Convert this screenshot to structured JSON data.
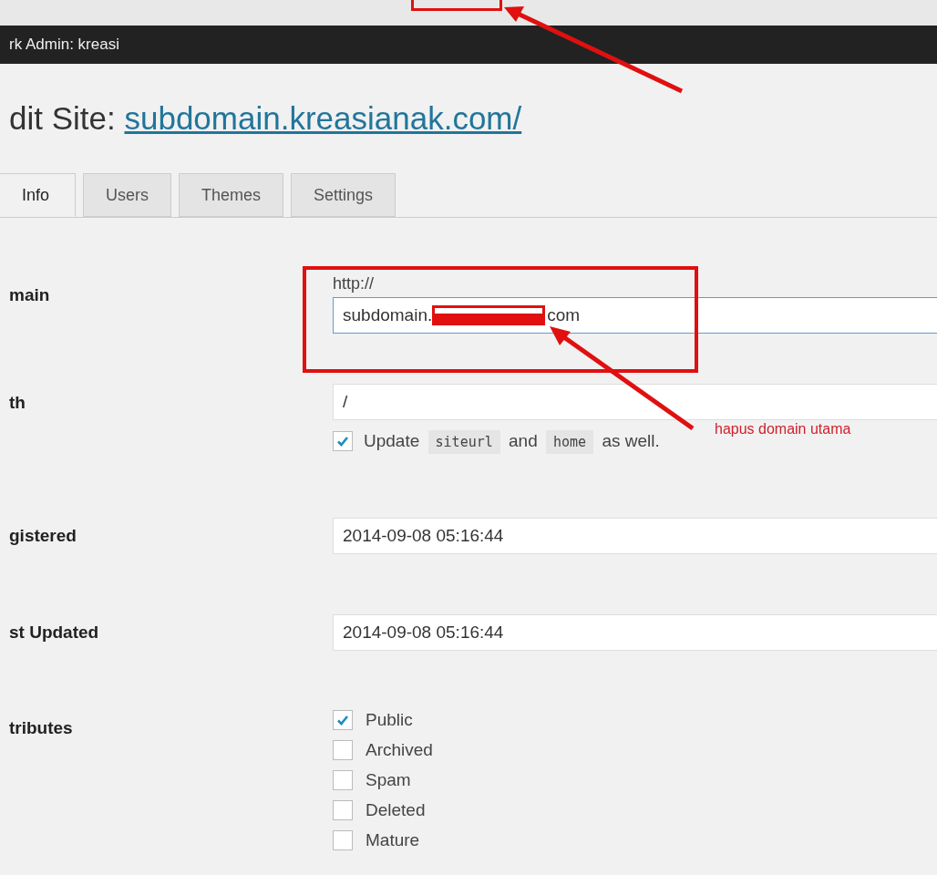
{
  "admin_bar": {
    "title": "rk Admin: kreasi"
  },
  "heading": {
    "prefix": "dit Site: ",
    "link": "subdomain.kreasianak.com/"
  },
  "tabs": [
    {
      "label": "Info",
      "selected": true
    },
    {
      "label": "Users",
      "selected": false
    },
    {
      "label": "Themes",
      "selected": false
    },
    {
      "label": "Settings",
      "selected": false
    }
  ],
  "form": {
    "domain": {
      "label": "main",
      "prefix": "http://",
      "value_start": "subdomain.",
      "value_end": "com"
    },
    "path": {
      "label": "th",
      "value": "/",
      "update_checked": true,
      "update_parts": [
        "Update ",
        "siteurl",
        " and ",
        "home",
        " as well."
      ]
    },
    "registered": {
      "label": "gistered",
      "value": "2014-09-08 05:16:44"
    },
    "last_updated": {
      "label": "st Updated",
      "value": "2014-09-08 05:16:44"
    },
    "attributes": {
      "label": "tributes",
      "options": [
        {
          "label": "Public",
          "checked": true
        },
        {
          "label": "Archived",
          "checked": false
        },
        {
          "label": "Spam",
          "checked": false
        },
        {
          "label": "Deleted",
          "checked": false
        },
        {
          "label": "Mature",
          "checked": false
        }
      ]
    }
  },
  "annotation": {
    "note": "hapus domain utama"
  }
}
